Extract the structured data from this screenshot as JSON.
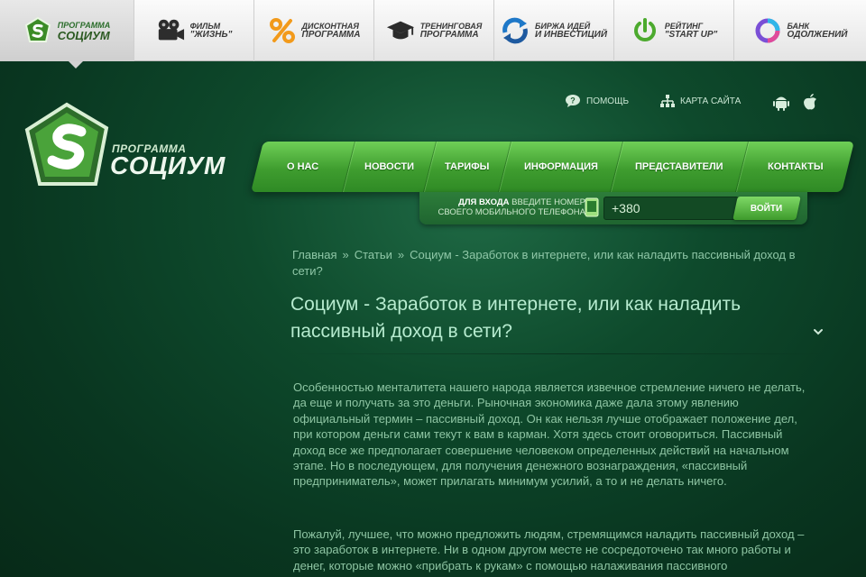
{
  "topbar": {
    "items": [
      {
        "line1": "ПРОГРАММА",
        "line2": "СОЦИУМ",
        "icon": "socium-logo-icon"
      },
      {
        "line1": "ФИЛЬМ",
        "line2": "\"ЖИЗНЬ\"",
        "icon": "film-camera-icon"
      },
      {
        "line1": "ДИСКОНТНАЯ",
        "line2": "ПРОГРАММА",
        "icon": "percent-icon"
      },
      {
        "line1": "ТРЕНИНГОВАЯ",
        "line2": "ПРОГРАММА",
        "icon": "graduation-cap-icon"
      },
      {
        "line1": "БИРЖА ИДЕЙ",
        "line2": "И ИНВЕСТИЦИЙ",
        "icon": "exchange-arrows-icon"
      },
      {
        "line1": "РЕЙТИНГ",
        "line2": "\"START UP\"",
        "icon": "power-icon"
      },
      {
        "line1": "БАНК",
        "line2": "ОДОЛЖЕНИЙ",
        "icon": "bank-ring-icon"
      }
    ],
    "active_index": 0
  },
  "header": {
    "logo_small": "ПРОГРАММА",
    "logo_big": "СОЦИУМ",
    "help_label": "ПОМОЩЬ",
    "sitemap_label": "КАРТА САЙТА"
  },
  "nav": {
    "items": [
      "О НАС",
      "НОВОСТИ",
      "ТАРИФЫ",
      "ИНФОРМАЦИЯ",
      "ПРЕДСТАВИТЕЛИ",
      "КОНТАКТЫ"
    ]
  },
  "login": {
    "label_bold": "ДЛЯ ВХОДА",
    "label_rest": " ВВЕДИТЕ НОМЕР СВОЕГО МОБИЛЬНОГО ТЕЛЕФОНА",
    "phone_value": "+380",
    "button_label": "ВОЙТИ"
  },
  "breadcrumb": {
    "home": "Главная",
    "section": "Статьи",
    "current": "Социум - Заработок в интернете, или как наладить пассивный доход в сети?",
    "separator": "»"
  },
  "article": {
    "title": "Социум - Заработок в интернете, или как наладить пассивный доход в сети?",
    "p1": "Особенностью менталитета нашего народа является извечное стремление ничего не делать, да еще и получать за это деньги. Рыночная экономика даже дала этому явлению официальный термин – пассивный доход. Он как нельзя лучше отображает положение дел, при котором деньги сами текут к вам в карман. Хотя здесь стоит оговориться. Пассивный доход все же предполагает совершение человеком определенных действий на начальном этапе. Но в последующем, для получения денежного вознаграждения, «пассивный предприниматель», может прилагать минимум усилий, а то и не делать ничего.",
    "p2": "Пожалуй, лучшее, что можно предложить людям, стремящимся наладить пассивный доход – это заработок в интернете. Ни в одном другом месте не сосредоточено так много работы и денег, которые можно «прибрать к рукам» с помощью налаживания пассивного"
  },
  "colors": {
    "background": "#0e4a2c",
    "nav_green": "#4fb03a",
    "text_light": "#8ec5a3"
  }
}
